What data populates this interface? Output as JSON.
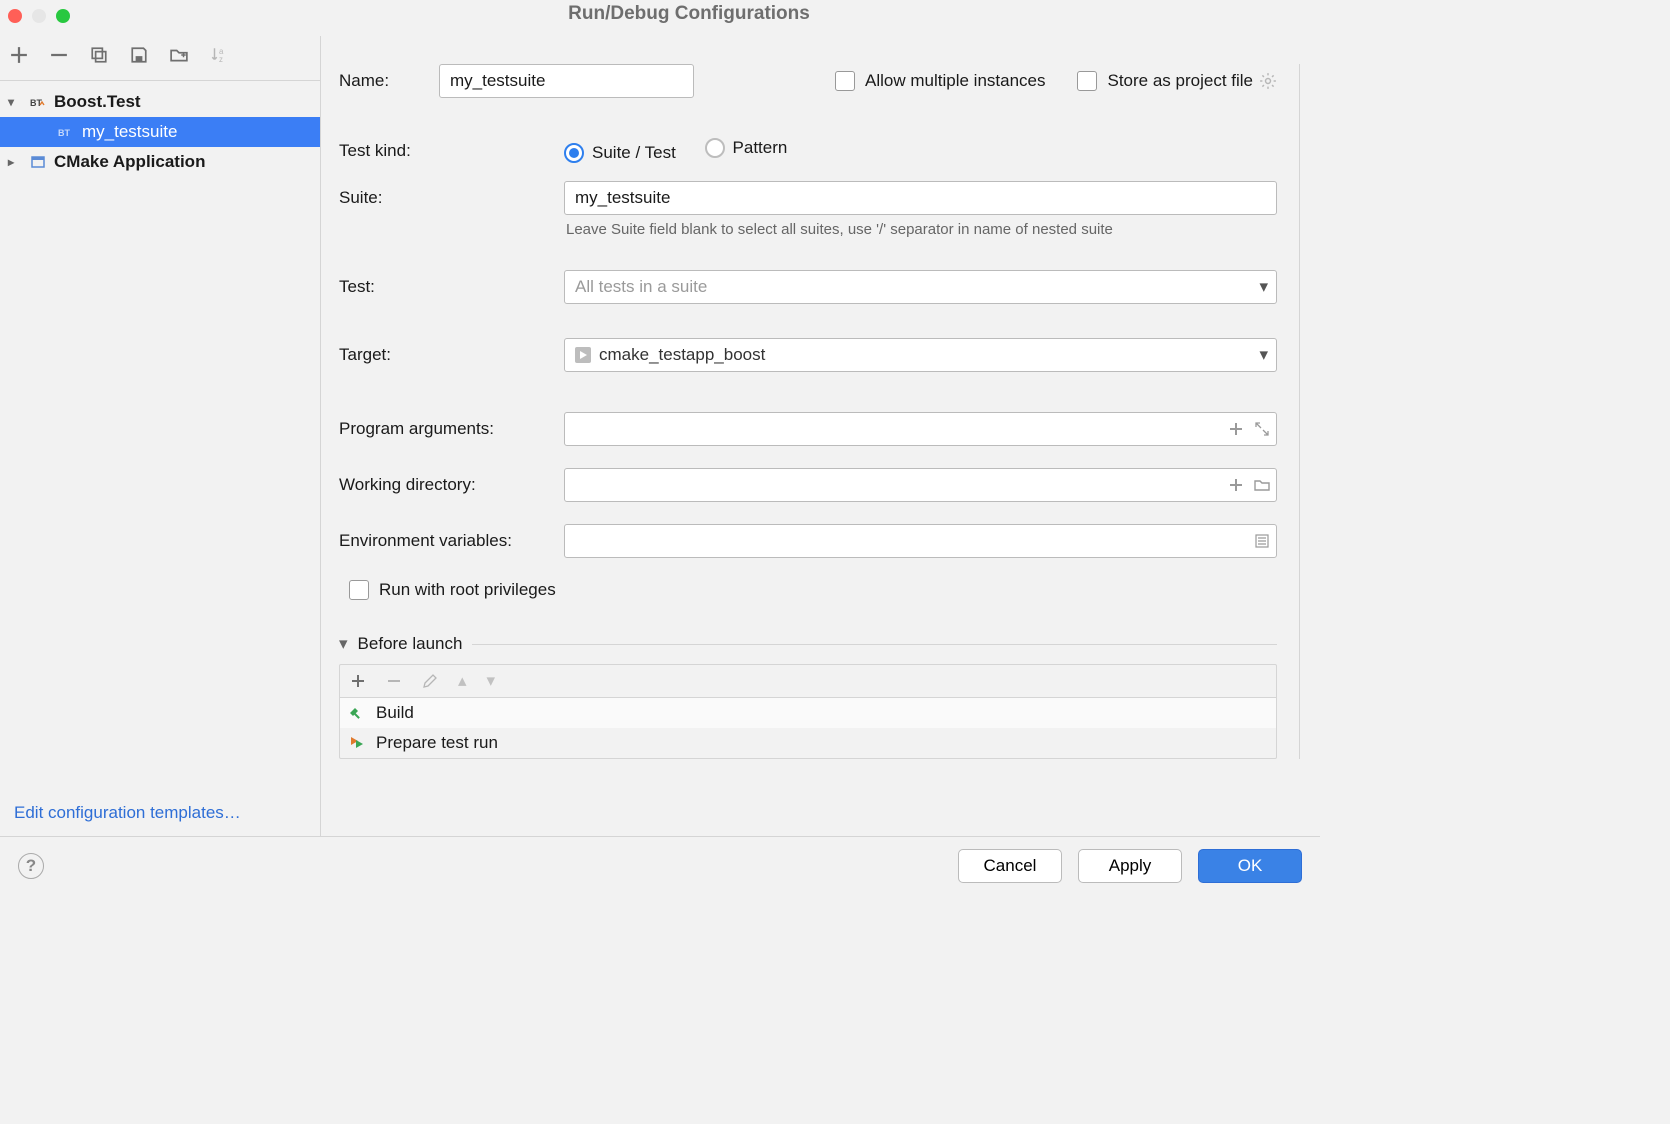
{
  "window": {
    "title": "Run/Debug Configurations"
  },
  "sidebar": {
    "edit_templates": "Edit configuration templates…",
    "tree": {
      "boost_test": "Boost.Test",
      "my_testsuite": "my_testsuite",
      "cmake_app": "CMake Application"
    }
  },
  "form": {
    "name_label": "Name:",
    "name_value": "my_testsuite",
    "allow_multiple": "Allow multiple instances",
    "store_as_project_file": "Store as project file",
    "test_kind_label": "Test kind:",
    "test_kind_opt1": "Suite / Test",
    "test_kind_opt2": "Pattern",
    "suite_label": "Suite:",
    "suite_value": "my_testsuite",
    "suite_hint": "Leave Suite field blank to select all suites, use '/' separator in name of nested suite",
    "test_label": "Test:",
    "test_placeholder": "All tests in a suite",
    "target_label": "Target:",
    "target_value": "cmake_testapp_boost",
    "prog_args_label": "Program arguments:",
    "work_dir_label": "Working directory:",
    "env_vars_label": "Environment variables:",
    "run_root": "Run with root privileges",
    "before_launch": "Before launch",
    "tasks": {
      "build": "Build",
      "prepare": "Prepare test run"
    }
  },
  "buttons": {
    "cancel": "Cancel",
    "apply": "Apply",
    "ok": "OK"
  }
}
